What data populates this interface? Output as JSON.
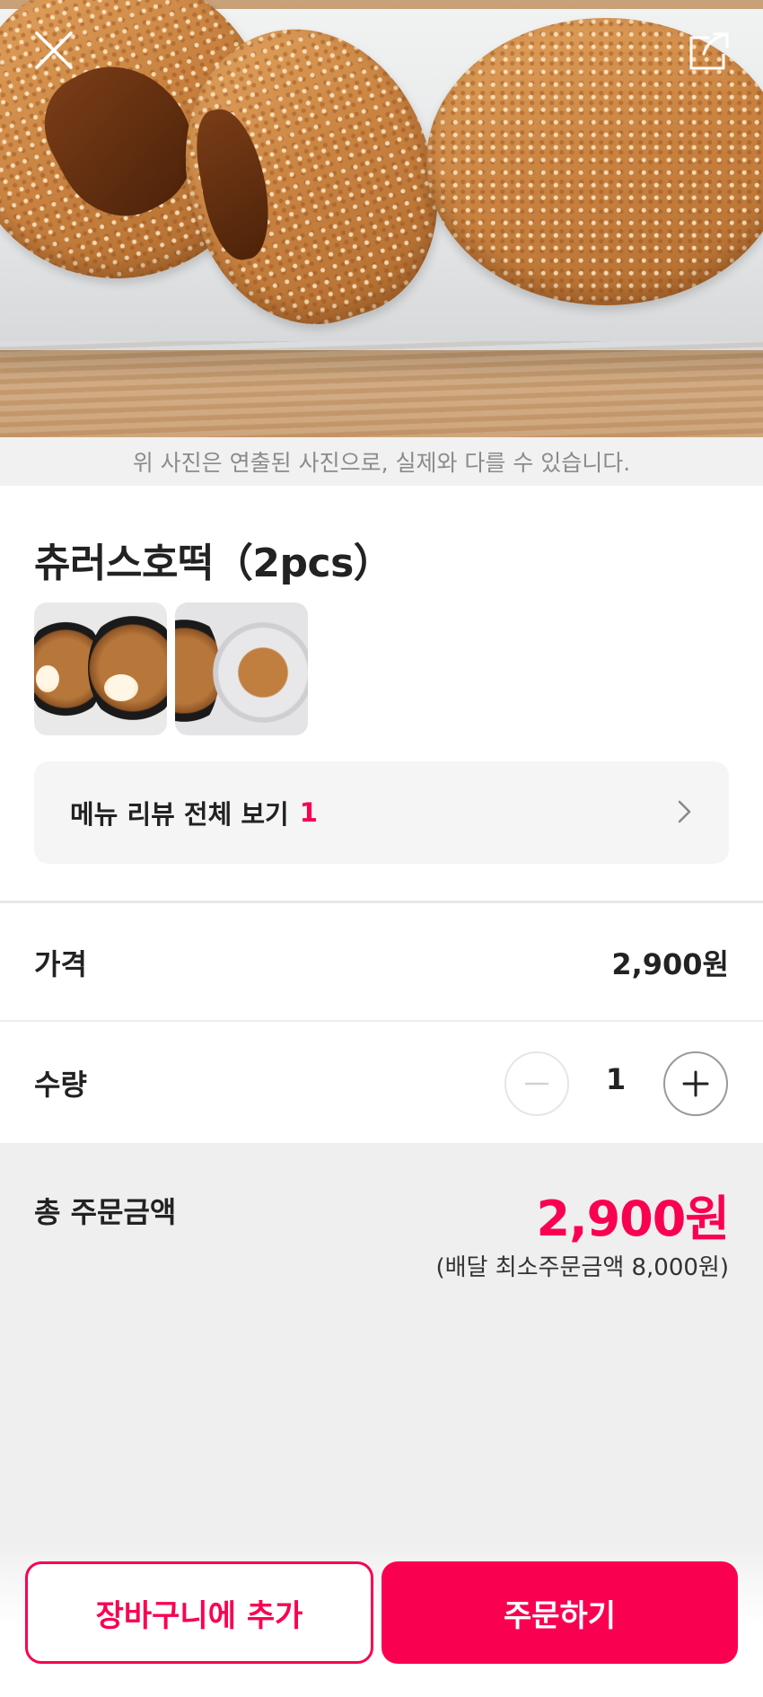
{
  "header": {
    "close_icon": "close-icon",
    "share_icon": "share-icon"
  },
  "photo_note": "위 사진은 연출된 사진으로, 실제와 다를 수 있습니다.",
  "menu": {
    "title": "츄러스호떡（2pcs）",
    "review_label": "메뉴 리뷰 전체 보기",
    "review_count": "1"
  },
  "price": {
    "label": "가격",
    "value": "2,900원"
  },
  "quantity": {
    "label": "수량",
    "value": "1",
    "minus_icon": "minus-icon",
    "plus_icon": "plus-icon"
  },
  "total": {
    "label": "총 주문금액",
    "value": "2,900원",
    "min_order": "(배달 최소주문금액 8,000원)"
  },
  "actions": {
    "cart_label": "장바구니에 추가",
    "order_label": "주문하기"
  },
  "colors": {
    "accent": "#fa0050",
    "text": "#222222"
  }
}
